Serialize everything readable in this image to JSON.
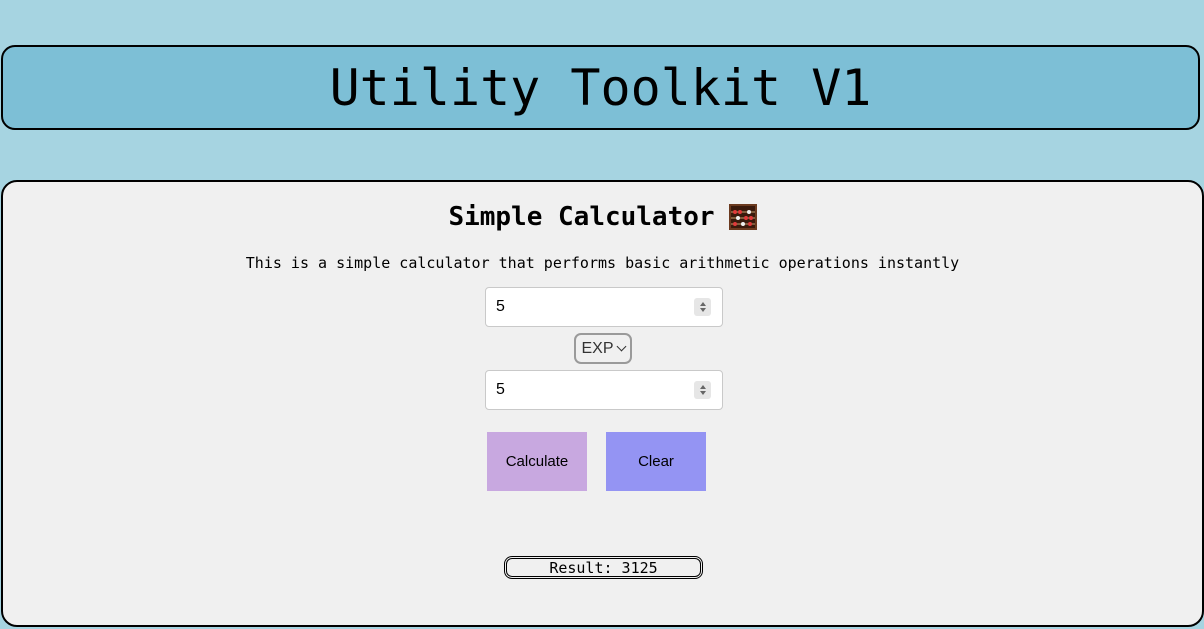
{
  "header": {
    "title": "Utility Toolkit V1"
  },
  "calculator": {
    "title": "Simple Calculator",
    "title_icon": "abacus-icon",
    "description": "This is a simple calculator that performs basic arithmetic operations instantly",
    "first_number": "5",
    "operator": "EXP",
    "second_number": "5",
    "calculate_label": "Calculate",
    "clear_label": "Clear",
    "result_text": "Result: 3125"
  },
  "colors": {
    "page_background": "#a6d4e1",
    "header_background": "#7dbfd6",
    "panel_background": "#f0f0f0",
    "calculate_button": "#c8a8e0",
    "clear_button": "#9494f3"
  }
}
